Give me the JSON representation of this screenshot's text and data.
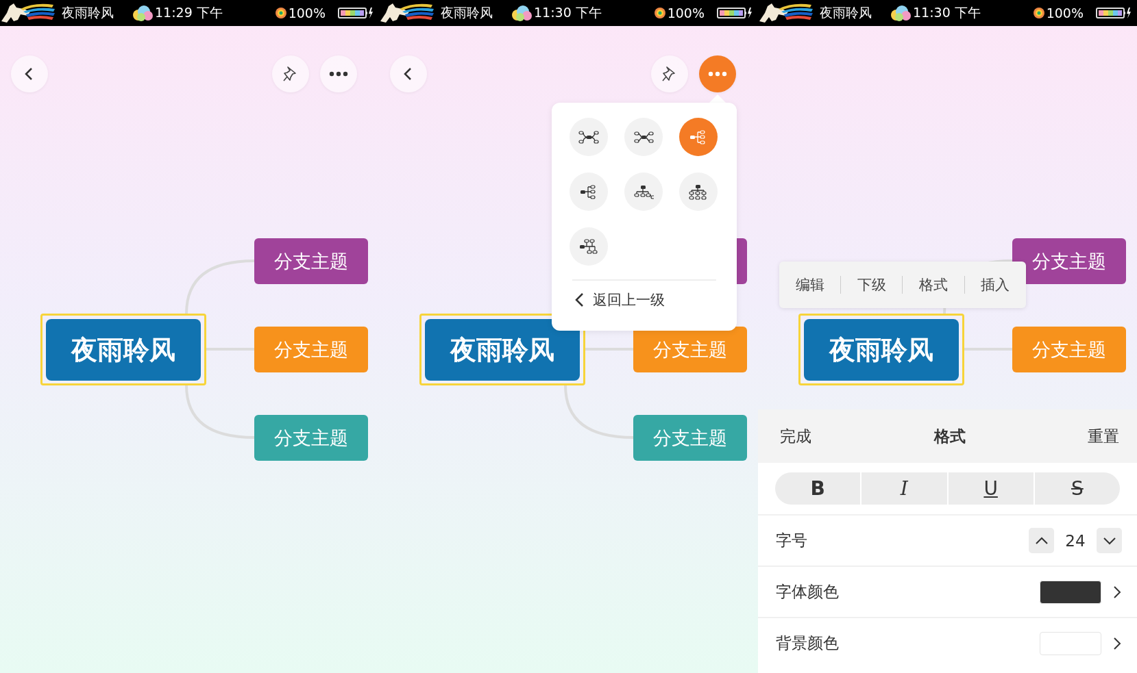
{
  "screens": [
    {
      "status_bar": {
        "carrier": "夜雨聆风",
        "time": "11:29 下午",
        "battery": "100%"
      },
      "toolbar": {
        "more_selected": false
      },
      "mind_map": {
        "root": "夜雨聆风",
        "root_selected": true,
        "branches": [
          {
            "label": "分支主题",
            "color": "#a0439a"
          },
          {
            "label": "分支主题",
            "color": "#f7921c"
          },
          {
            "label": "分支主题",
            "color": "#36a8a4"
          }
        ]
      }
    },
    {
      "status_bar": {
        "carrier": "夜雨聆风",
        "time": "11:30 下午",
        "battery": "100%"
      },
      "toolbar": {
        "more_selected": true
      },
      "mind_map": {
        "root": "夜雨聆风",
        "root_selected": true,
        "branches": [
          {
            "color": "#a0439a"
          },
          {
            "label": "分支主题",
            "color": "#f7921c"
          },
          {
            "label": "分支主题",
            "color": "#36a8a4"
          }
        ]
      },
      "layout_menu": {
        "options": [
          {
            "kind": "mind_map",
            "selected": false
          },
          {
            "kind": "mind_map_balanced",
            "selected": false
          },
          {
            "kind": "logic_right",
            "selected": true
          },
          {
            "kind": "tree_right",
            "selected": false
          },
          {
            "kind": "tree_down",
            "selected": false
          },
          {
            "kind": "org_chart",
            "selected": false
          },
          {
            "kind": "timeline",
            "selected": false
          }
        ],
        "back": "返回上一级"
      }
    },
    {
      "status_bar": {
        "carrier": "夜雨聆风",
        "time": "11:30 下午",
        "battery": "100%"
      },
      "mind_map": {
        "root": "夜雨聆风",
        "root_selected": true,
        "branches": [
          {
            "label": "分支主题",
            "color": "#a0439a"
          },
          {
            "label": "分支主题",
            "color": "#f7921c"
          }
        ]
      },
      "context_menu": [
        "编辑",
        "下级",
        "格式",
        "插入"
      ],
      "format_sheet": {
        "done": "完成",
        "title": "格式",
        "reset": "重置",
        "styles": [
          {
            "kind": "bold",
            "label": "B",
            "selected": false
          },
          {
            "kind": "italic",
            "label": "I",
            "selected": false
          },
          {
            "kind": "underline",
            "label": "U",
            "selected": false
          },
          {
            "kind": "strike",
            "label": "S",
            "selected": false
          }
        ],
        "font_size": {
          "label": "字号",
          "value": "24"
        },
        "font_color": {
          "label": "字体颜色",
          "color": "#333333"
        },
        "background_color": {
          "label": "背景颜色",
          "color": "#ffffff"
        }
      }
    }
  ]
}
